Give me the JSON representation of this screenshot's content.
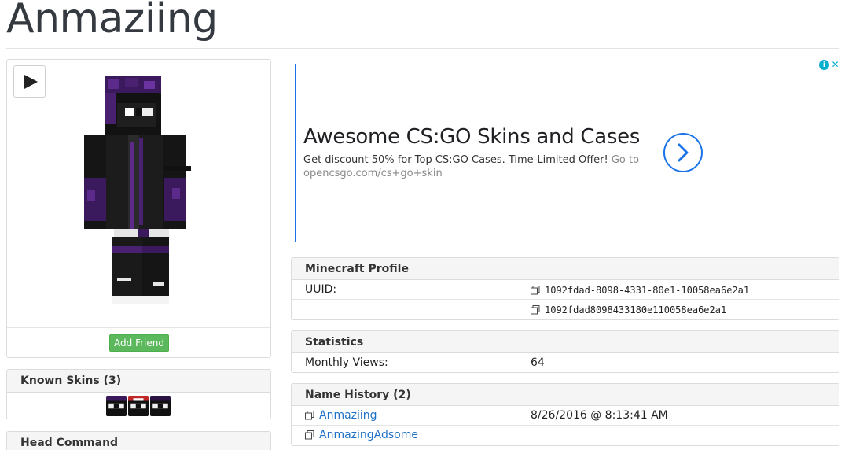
{
  "page": {
    "title": "Anmaziing"
  },
  "skin_viewer": {
    "play_icon": "play-icon",
    "add_friend_label": "Add Friend"
  },
  "known_skins": {
    "title": "Known Skins (3)",
    "count": 3
  },
  "head_command": {
    "title": "Head Command"
  },
  "ad": {
    "headline": "Awesome CS:GO Skins and Cases",
    "description": "Get discount 50% for Top CS:GO Cases. Time-Limited Offer!",
    "go_to": "Go to",
    "url": "opencsgo.com/cs+go+skin",
    "info_icon": "info-icon",
    "close_icon": "close-icon",
    "arrow_icon": "chevron-right-icon",
    "accent_color": "#1a73e8"
  },
  "profile": {
    "title": "Minecraft Profile",
    "uuid_label": "UUID:",
    "uuid_dashed": "1092fdad-8098-4331-80e1-10058ea6e2a1",
    "uuid_plain": "1092fdad8098433180e110058ea6e2a1"
  },
  "statistics": {
    "title": "Statistics",
    "monthly_views_label": "Monthly Views:",
    "monthly_views_value": "64"
  },
  "name_history": {
    "title": "Name History (2)",
    "entries": [
      {
        "name": "Anmaziing",
        "date": "8/26/2016 @ 8:13:41 AM"
      },
      {
        "name": "AnmazingAdsome",
        "date": ""
      }
    ]
  },
  "colors": {
    "link": "#1e6fc7",
    "button_green": "#5cb85c"
  }
}
